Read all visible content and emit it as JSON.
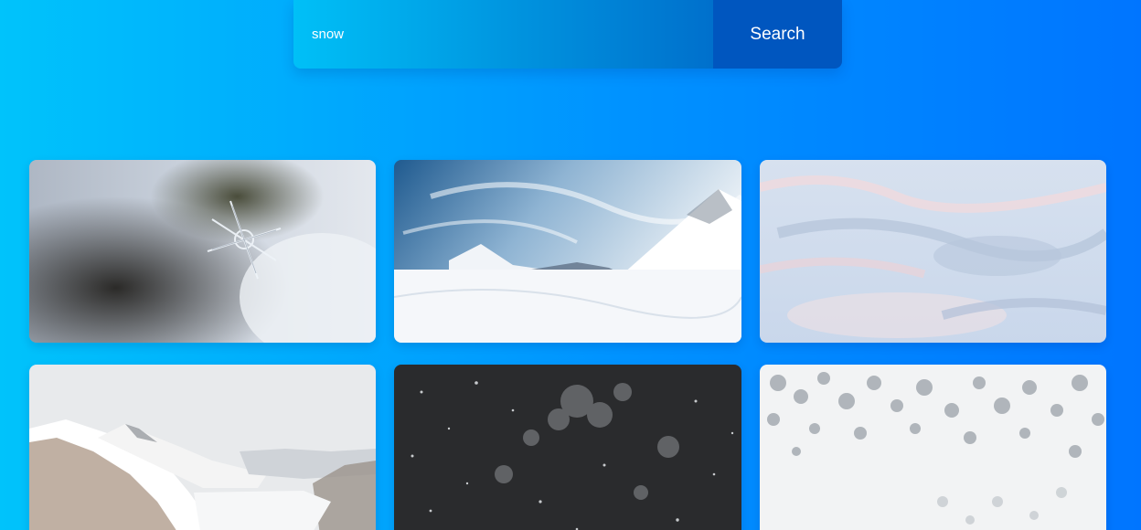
{
  "search": {
    "value": "snow",
    "button_label": "Search"
  },
  "results": [
    {
      "subject": "snowflake-closeup"
    },
    {
      "subject": "snowy-mountain-peak"
    },
    {
      "subject": "snow-dunes"
    },
    {
      "subject": "snowy-mountain-range"
    },
    {
      "subject": "falling-snow-night"
    },
    {
      "subject": "snow-forest-aerial"
    }
  ],
  "colors": {
    "background_start": "#00c3fb",
    "background_end": "#0075ff",
    "button": "#0056bf"
  }
}
